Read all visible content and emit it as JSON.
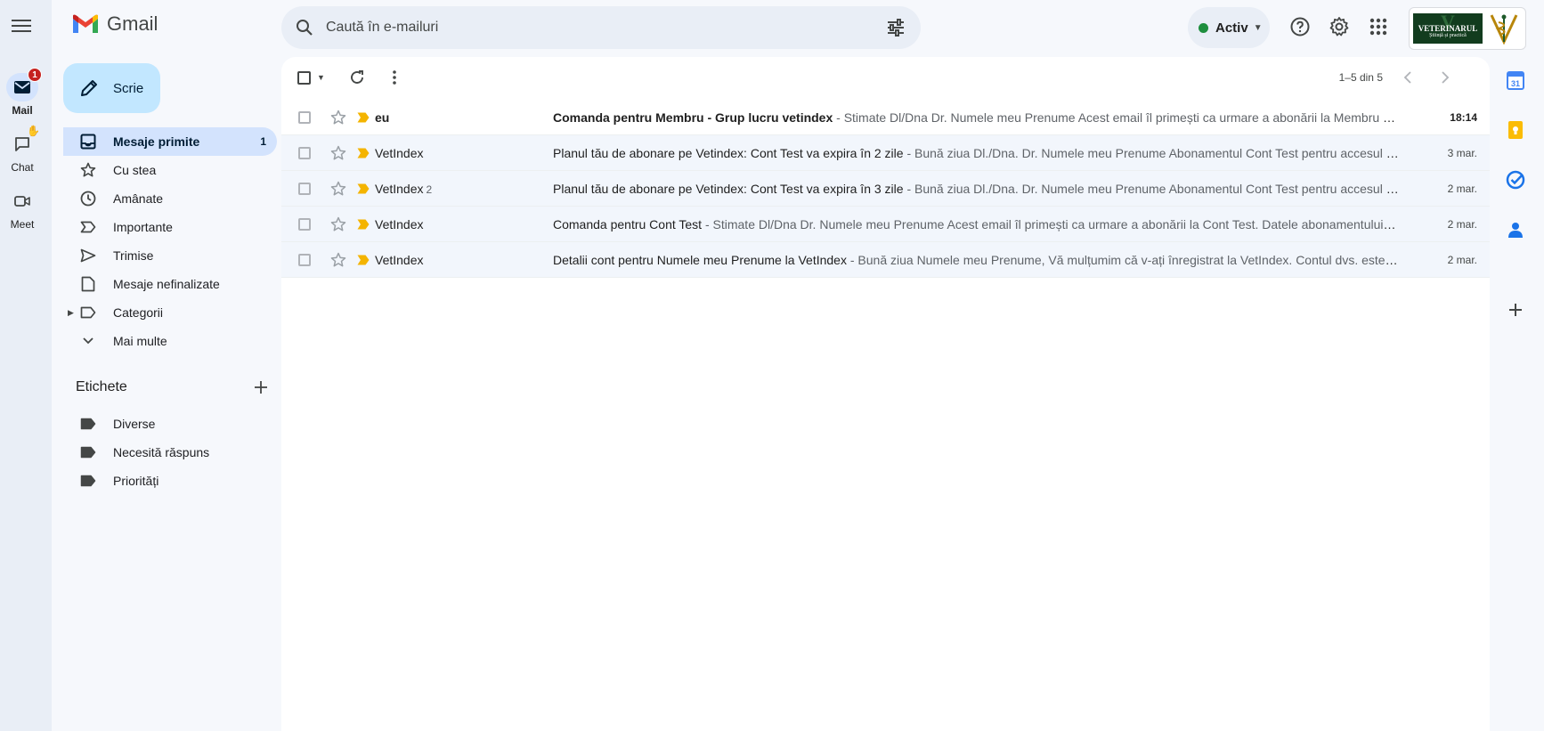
{
  "rail": {
    "items": [
      {
        "label": "Mail",
        "badge": "1"
      },
      {
        "label": "Chat"
      },
      {
        "label": "Meet"
      }
    ]
  },
  "app": {
    "name": "Gmail"
  },
  "search": {
    "placeholder": "Caută în e-mailuri"
  },
  "status": {
    "label": "Activ",
    "color": "#1e8e3e"
  },
  "compose": {
    "label": "Scrie"
  },
  "nav": [
    {
      "label": "Mesaje primite",
      "count": "1"
    },
    {
      "label": "Cu stea"
    },
    {
      "label": "Amânate"
    },
    {
      "label": "Importante"
    },
    {
      "label": "Trimise"
    },
    {
      "label": "Mesaje nefinalizate"
    },
    {
      "label": "Categorii"
    },
    {
      "label": "Mai multe"
    }
  ],
  "labels": {
    "heading": "Etichete",
    "items": [
      "Diverse",
      "Necesită răspuns",
      "Priorități"
    ]
  },
  "account": {
    "logo_line1": "VETERINARUL",
    "logo_line2": "Știință și practică",
    "logo_letter": "V"
  },
  "pager": {
    "text": "1–5 din 5"
  },
  "emails": [
    {
      "sender": "eu",
      "count": "",
      "subject": "Comanda pentru Membru - Grup lucru vetindex",
      "snippet": " - Stimate Dl/Dna Dr. Numele meu Prenume Acest email îl primești ca urmare a abonării la Membru - Grup lucru vetindex.",
      "date": "18:14",
      "unread": true
    },
    {
      "sender": "VetIndex",
      "count": "",
      "subject": "Planul tău de abonare pe Vetindex: Cont Test va expira în 2 zile",
      "snippet": " - Bună ziua Dl./Dna. Dr. Numele meu Prenume Abonamentul Cont Test pentru accesul la VetIndex.",
      "date": "3 mar.",
      "unread": false
    },
    {
      "sender": "VetIndex",
      "count": "2",
      "subject": "Planul tău de abonare pe Vetindex: Cont Test va expira în 3 zile",
      "snippet": " - Bună ziua Dl./Dna. Dr. Numele meu Prenume Abonamentul Cont Test pentru accesul la VetIndex.",
      "date": "2 mar.",
      "unread": false
    },
    {
      "sender": "VetIndex",
      "count": "",
      "subject": "Comanda pentru Cont Test",
      "snippet": " - Stimate Dl/Dna Dr. Numele meu Prenume Acest email îl primești ca urmare a abonării la Cont Test. Datele abonamentului sunt:",
      "date": "2 mar.",
      "unread": false
    },
    {
      "sender": "VetIndex",
      "count": "",
      "subject": "Detalii cont pentru Numele meu Prenume la VetIndex",
      "snippet": " - Bună ziua Numele meu Prenume, Vă mulțumim că v-ați înregistrat la VetIndex. Contul dvs. este creat.",
      "date": "2 mar.",
      "unread": false
    }
  ]
}
